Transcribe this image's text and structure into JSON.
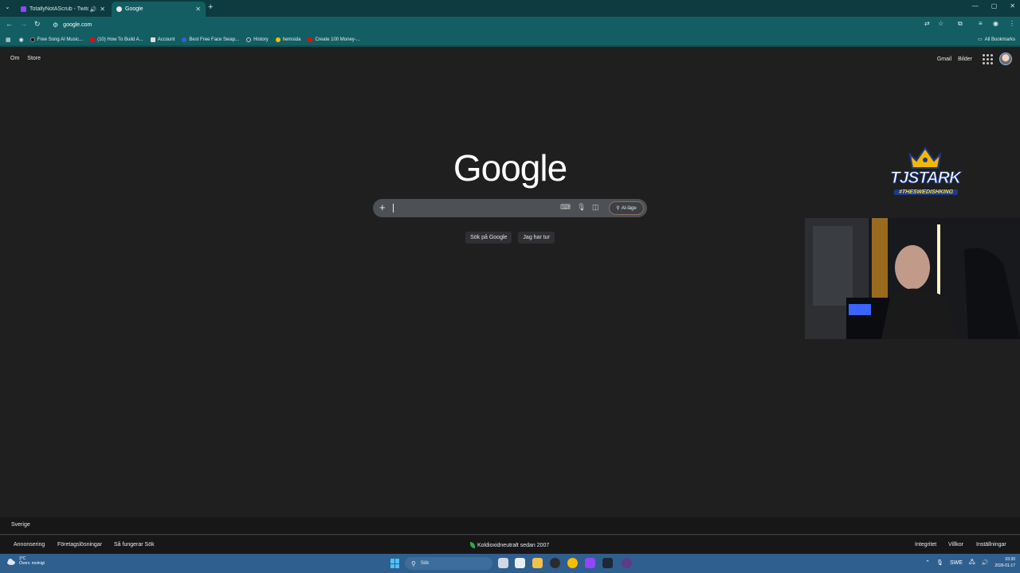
{
  "browser": {
    "tabs": [
      {
        "title": "TotallyNotAScrub - Twitch",
        "active": false,
        "favicon_color": "#9146ff"
      },
      {
        "title": "Google",
        "active": true,
        "favicon_color": "#e8eaed"
      }
    ],
    "url": "google.com",
    "bookmarks": [
      {
        "label": "Free Song AI Music...",
        "color": "#111111"
      },
      {
        "label": "(10) How To Build A...",
        "color": "#ff0000"
      },
      {
        "label": "Account",
        "color": "#444444"
      },
      {
        "label": "Best Free Face Swap...",
        "color": "#3b5bdb"
      },
      {
        "label": "History",
        "color": "#9aa0a6"
      },
      {
        "label": "hemsida",
        "color": "#fbbc04"
      },
      {
        "label": "Create 100 Money-...",
        "color": "#ff0000"
      }
    ],
    "all_bookmarks": "All Bookmarks"
  },
  "google": {
    "top_left": [
      "Om",
      "Store"
    ],
    "top_right": [
      "Gmail",
      "Bilder"
    ],
    "logo": "Google",
    "search_placeholder": "",
    "ai_mode": "AI-läge",
    "buttons": [
      "Sök på Google",
      "Jag har tur"
    ],
    "country": "Sverige",
    "footer_left": [
      "Annonsering",
      "Företagslösningar",
      "Så fungerar Sök"
    ],
    "footer_center": "Koldioxidneutralt sedan 2007",
    "footer_right": [
      "Integritet",
      "Villkor",
      "Inställningar"
    ]
  },
  "overlay": {
    "brand": "TJSTARK",
    "tagline": "#THESWEDISHKING"
  },
  "taskbar": {
    "weather_temp": "3°C",
    "weather_desc": "Överv. molnigt",
    "search_label": "Sök",
    "language": "SWE",
    "time": "03:30",
    "date": "2026-01-17"
  },
  "colors": {
    "tabstrip": "#0d3b3f",
    "toolbar": "#135e63",
    "page_bg": "#1f1f1f",
    "taskbar": "#2f5f8f"
  }
}
